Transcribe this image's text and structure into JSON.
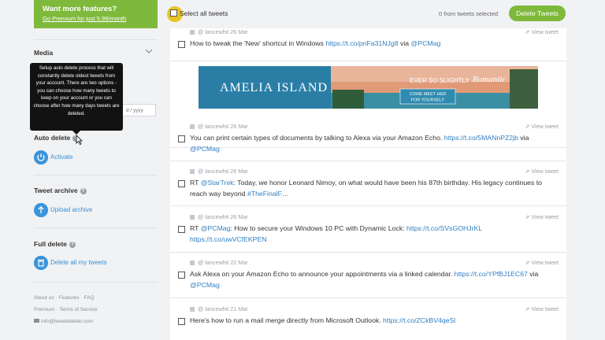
{
  "sidebar": {
    "premium_title": "Want more features?",
    "premium_link": "Go Premium for just 5.99/month",
    "premium_arrow": "›",
    "media_label": "Media",
    "date_placeholder": "d / yyyy",
    "tooltip_text": "Setup auto delete process that will constantly delete oldest tweets from your account. There are two options - you can choose how many tweets to keep on your account or you can choose after how many days tweets are deleted.",
    "auto_delete_label": "Auto delete",
    "activate_label": "Activate",
    "tweet_archive_label": "Tweet archive",
    "upload_archive_label": "Upload archive",
    "full_delete_label": "Full delete",
    "delete_all_label": "Delete all my tweets",
    "footer": {
      "about": "About us",
      "features": "Features",
      "faq": "FAQ",
      "premium": "Premium",
      "terms": "Terms of Service",
      "email": "info@tweetdeleter.com",
      "sep": "·"
    }
  },
  "topbar": {
    "select_all": "Select all tweets",
    "from_selected": "0 from tweets selected",
    "delete_button": "Delete Tweets"
  },
  "ad": {
    "brand": "AMELIA ISLAND",
    "tagline_a": "EVER SO SLIGHTLY",
    "tagline_b": "Romantic",
    "cta_line1": "COME MEET HER",
    "cta_line2": "FOR YOURSELF"
  },
  "tweets": [
    {
      "meta": "@ lancewhit 26 Mar",
      "view": "View tweet",
      "parts": [
        {
          "t": "How to tweak the 'New' shortcut in Windows ",
          "link": false
        },
        {
          "t": "https://t.co/pnFa31NJg8",
          "link": true
        },
        {
          "t": " via ",
          "link": false
        },
        {
          "t": "@PCMag",
          "link": true
        }
      ]
    },
    {
      "meta": "@ lancewhit 26 Mar",
      "view": "View tweet",
      "parts": [
        {
          "t": "You can print certain types of documents by talking to Alexa via your Amazon Echo. ",
          "link": false
        },
        {
          "t": "https://t.co/5MANnPZ2jb",
          "link": true
        },
        {
          "t": " via ",
          "link": false
        },
        {
          "t": "@PCMag",
          "link": true
        }
      ]
    },
    {
      "meta": "@ lancewhit 26 Mar",
      "view": "View tweet",
      "parts": [
        {
          "t": "RT ",
          "link": false
        },
        {
          "t": "@StarTrek",
          "link": true
        },
        {
          "t": ": Today, we honor Leonard Nimoy, on what would have been his 87th birthday. His legacy continues to reach way beyond ",
          "link": false
        },
        {
          "t": "#TheFinalF",
          "link": true
        },
        {
          "t": "…",
          "link": false
        }
      ]
    },
    {
      "meta": "@ lancewhit 26 Mar",
      "view": "View tweet",
      "parts": [
        {
          "t": "RT ",
          "link": false
        },
        {
          "t": "@PCMag",
          "link": true
        },
        {
          "t": ": How to secure your Windows 10 PC with Dynamic Lock: ",
          "link": false
        },
        {
          "t": "https://t.co/SVsGOHJrKL",
          "link": true
        },
        {
          "t": " ",
          "link": false
        },
        {
          "t": "https://t.co/uwVCfEKPEN",
          "link": true
        }
      ]
    },
    {
      "meta": "@ lancewhit 22 Mar",
      "view": "View tweet",
      "parts": [
        {
          "t": "Ask Alexa on your Amazon Echo to announce your appointments via a linked calendar. ",
          "link": false
        },
        {
          "t": "https://t.co/YPfBJ1EC67",
          "link": true
        },
        {
          "t": " via ",
          "link": false
        },
        {
          "t": "@PCMag",
          "link": true
        }
      ]
    },
    {
      "meta": "@ lancewhit 21 Mar",
      "view": "View tweet",
      "parts": [
        {
          "t": "Here's how to run a mail merge directly from Microsoft Outlook. ",
          "link": false
        },
        {
          "t": "https://t.co/ZCkBV4qeSl",
          "link": true
        }
      ]
    }
  ]
}
